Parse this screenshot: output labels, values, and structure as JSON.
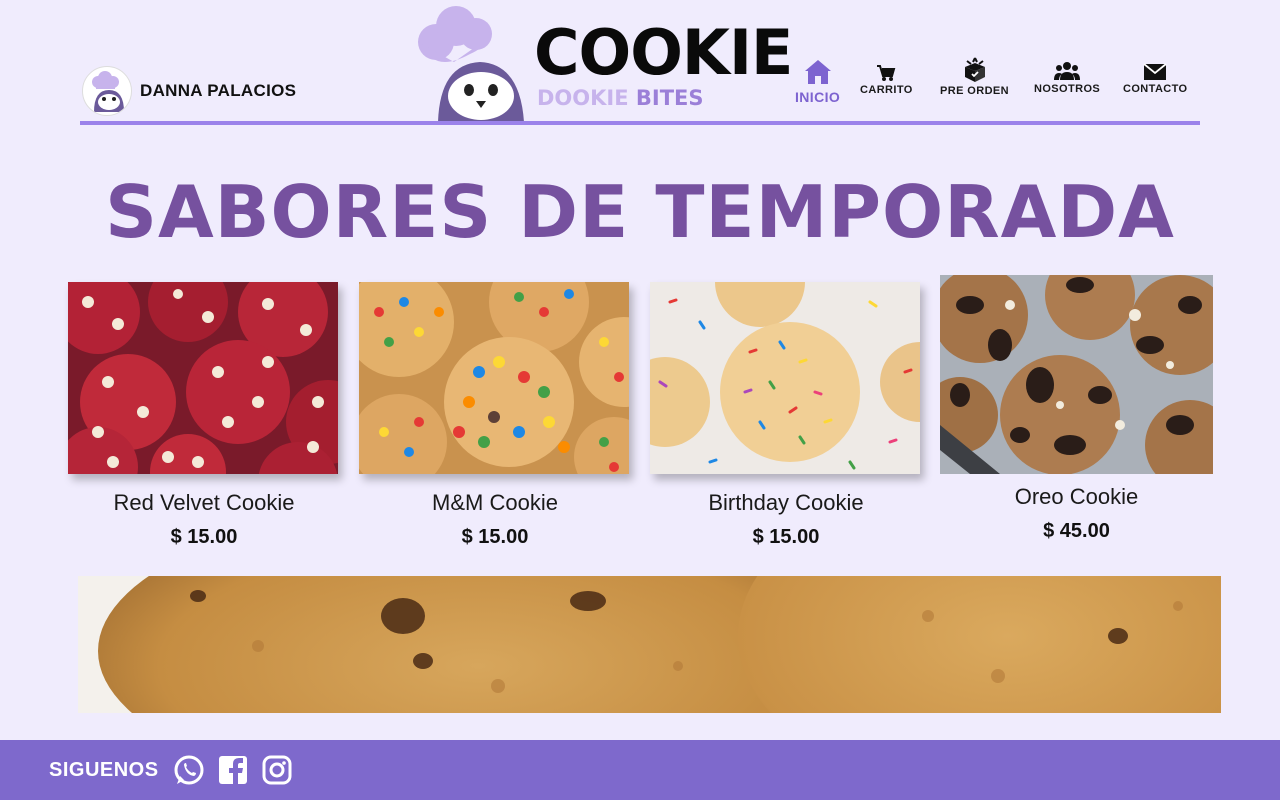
{
  "user": {
    "name": "DANNA PALACIOS"
  },
  "logo": {
    "main": "COOKIE",
    "sub_a": "DOOKIE",
    "sub_b": "BITES"
  },
  "nav": [
    {
      "label": "INICIO",
      "icon": "home-icon",
      "active": true
    },
    {
      "label": "CARRITO",
      "icon": "cart-icon"
    },
    {
      "label": "PRE ORDEN",
      "icon": "box-icon"
    },
    {
      "label": "NOSOTROS",
      "icon": "users-icon"
    },
    {
      "label": "CONTACTO",
      "icon": "mail-icon"
    }
  ],
  "page": {
    "title": "SABORES DE TEMPORADA"
  },
  "products": [
    {
      "name": "Red Velvet Cookie",
      "price": "$ 15.00"
    },
    {
      "name": "M&M Cookie",
      "price": "$ 15.00"
    },
    {
      "name": "Birthday Cookie",
      "price": "$ 15.00"
    },
    {
      "name": "Oreo Cookie",
      "price": "$ 45.00"
    }
  ],
  "footer": {
    "follow": "SIGUENOS",
    "social": [
      "whatsapp-icon",
      "facebook-icon",
      "instagram-icon"
    ]
  },
  "colors": {
    "background": "#f0ecfd",
    "accent": "#9b82ea",
    "title": "#76519f",
    "footer": "#7e69cc"
  }
}
